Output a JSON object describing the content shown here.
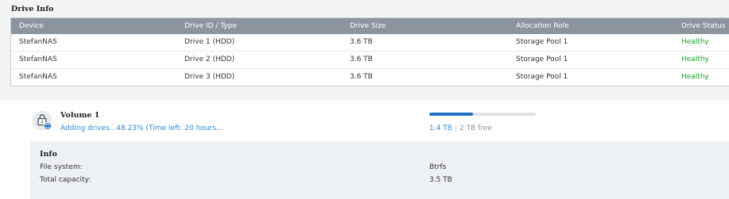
{
  "drive_info": {
    "title": "Drive Info",
    "columns": [
      "Device",
      "Drive ID / Type",
      "Drive Size",
      "Allocation Role",
      "Drive Status"
    ],
    "rows": [
      [
        "StefanNAS",
        "Drive 1 (HDD)",
        "3.6 TB",
        "Storage Pool 1",
        "Healthy"
      ],
      [
        "StefanNAS",
        "Drive 2 (HDD)",
        "3.6 TB",
        "Storage Pool 1",
        "Healthy"
      ],
      [
        "StefanNAS",
        "Drive 3 (HDD)",
        "3.6 TB",
        "Storage Pool 1",
        "Healthy"
      ]
    ],
    "status_color": "#1aa32b"
  },
  "volume": {
    "title": "Volume 1",
    "status": "Adding drives...48.23% (Time left: 20 hours...",
    "usage_fraction": 0.41,
    "used": "1.4 TB",
    "separator": "|",
    "free": "2 TB free",
    "icon": "lock-drive-icon",
    "accent_color": "#2b8ad6"
  },
  "info": {
    "title": "Info",
    "items": [
      {
        "label": "File system:",
        "value": "Btrfs"
      },
      {
        "label": "Total capacity:",
        "value": "3.5 TB"
      }
    ]
  }
}
